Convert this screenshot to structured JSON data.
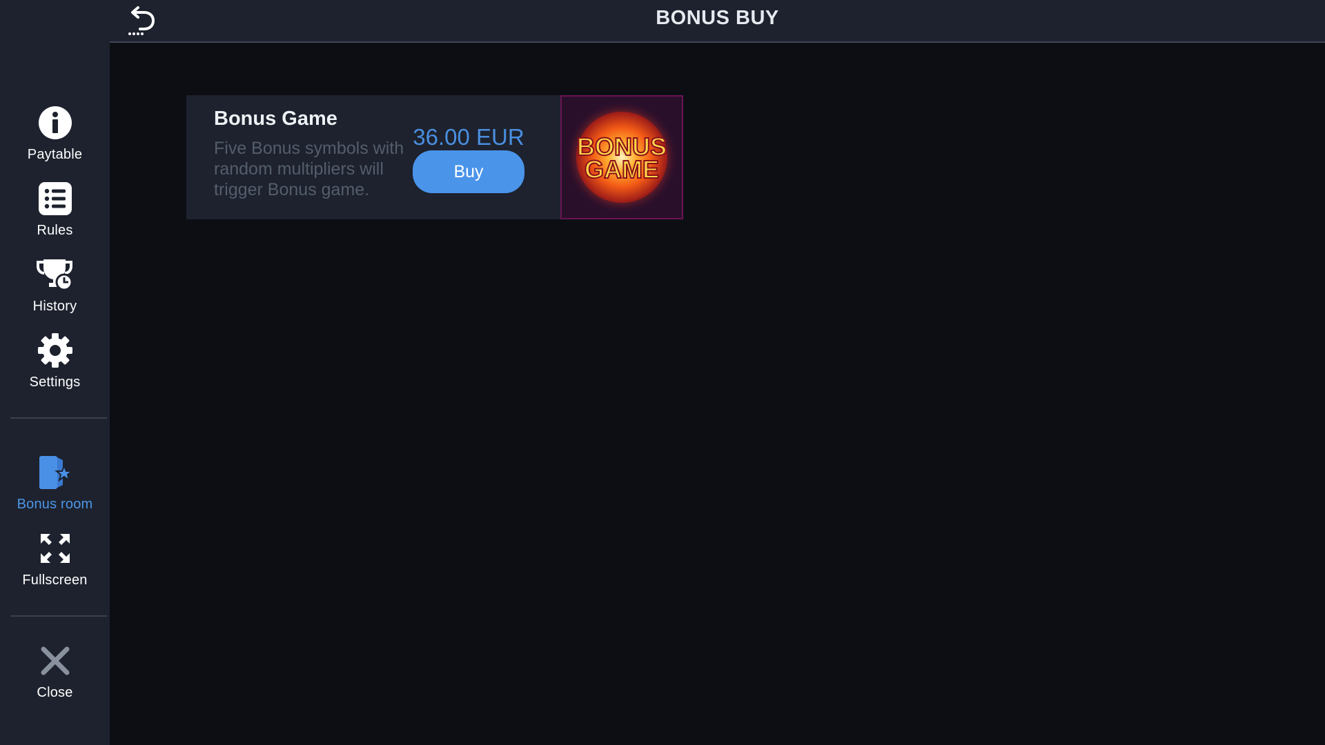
{
  "header": {
    "title": "BONUS BUY"
  },
  "sidebar": {
    "items": [
      {
        "label": "Paytable",
        "icon": "info-icon"
      },
      {
        "label": "Rules",
        "icon": "list-icon"
      },
      {
        "label": "History",
        "icon": "trophy-clock-icon"
      },
      {
        "label": "Settings",
        "icon": "gear-icon"
      },
      {
        "label": "Bonus room",
        "icon": "door-star-icon",
        "active": true
      },
      {
        "label": "Fullscreen",
        "icon": "fullscreen-icon"
      },
      {
        "label": "Close",
        "icon": "close-icon"
      }
    ]
  },
  "offer": {
    "title": "Bonus Game",
    "description": "Five Bonus symbols with random multipliers will trigger Bonus game.",
    "price": "36.00 EUR",
    "buy_label": "Buy",
    "image_text": "BONUS GAME"
  },
  "colors": {
    "background": "#0c0e14",
    "panel": "#1d222e",
    "accent": "#4a94ea",
    "active_nav": "#4d96e8"
  }
}
